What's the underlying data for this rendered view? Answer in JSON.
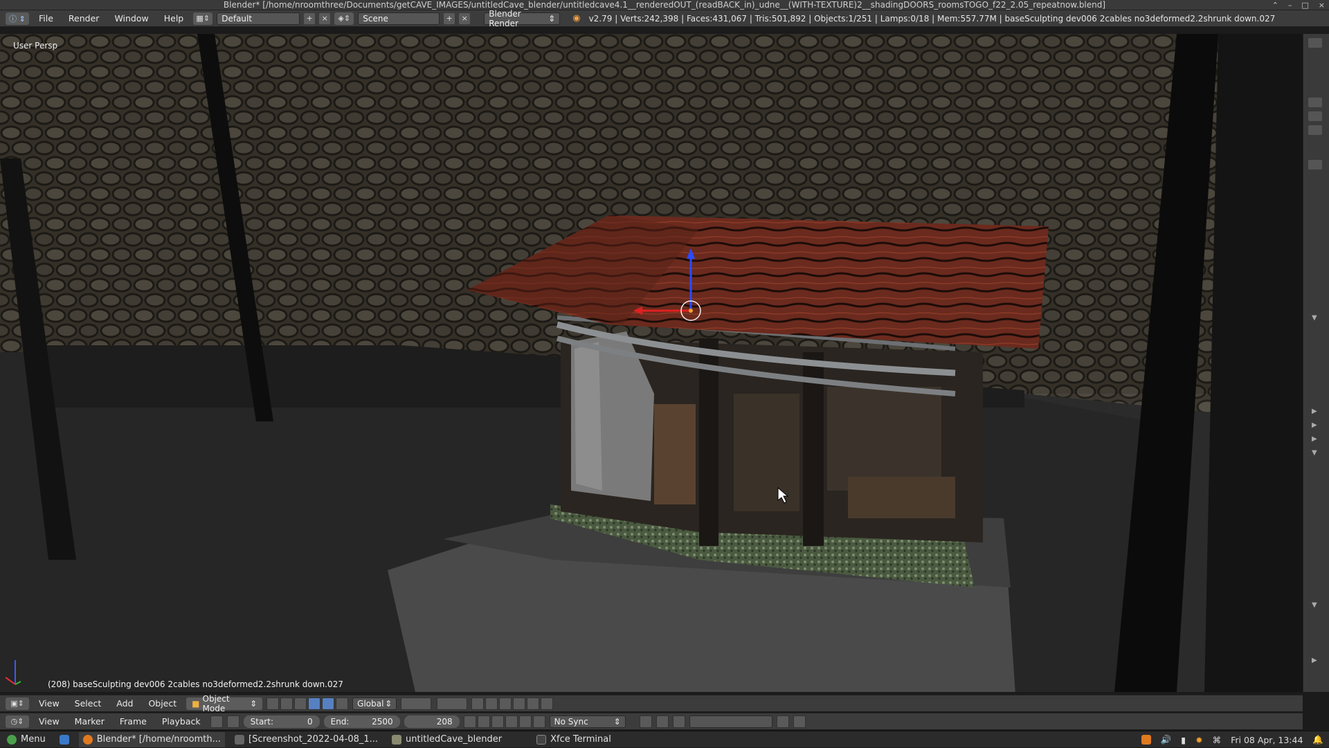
{
  "window": {
    "title": "Blender* [/home/nroomthree/Documents/getCAVE_IMAGES/untitledCave_blender/untitledcave4.1__renderedOUT_(readBACK_in)_udne__(WITH-TEXTURE)2__shadingDOORS_roomsTOGO_f22_2.05_repeatnow.blend]",
    "controls": [
      "⌃",
      "–",
      "□",
      "×"
    ]
  },
  "info_header": {
    "menus": [
      "File",
      "Render",
      "Window",
      "Help"
    ],
    "screen_layout": "Default",
    "scene": "Scene",
    "engine": "Blender Render",
    "stats": "v2.79 | Verts:242,398 | Faces:431,067 | Tris:501,892 | Objects:1/251 | Lamps:0/18 | Mem:557.77M | baseSculpting  dev006 2cables no3deformed2.2shrunk down.027"
  },
  "viewport": {
    "view_label": "User Persp",
    "object_label": "(208) baseSculpting  dev006 2cables no3deformed2.2shrunk down.027"
  },
  "header_3d": {
    "menus": [
      "View",
      "Select",
      "Add",
      "Object"
    ],
    "mode": "Object Mode",
    "orientation": "Global"
  },
  "timeline": {
    "menus": [
      "View",
      "Marker",
      "Frame",
      "Playback"
    ],
    "start_label": "Start:",
    "start_value": "0",
    "end_label": "End:",
    "end_value": "2500",
    "current_frame": "208",
    "sync": "No Sync"
  },
  "taskbar": {
    "menu": "Menu",
    "items": [
      "Blender* [/home/nroomth...",
      "[Screenshot_2022-04-08_1...",
      "untitledCave_blender",
      "Xfce Terminal"
    ],
    "clock": "Fri 08 Apr, 13:44"
  },
  "colors": {
    "accent": "#5680c2",
    "roof": "#6e2a1e",
    "stone": "#4a4438",
    "floor": "#262626"
  }
}
